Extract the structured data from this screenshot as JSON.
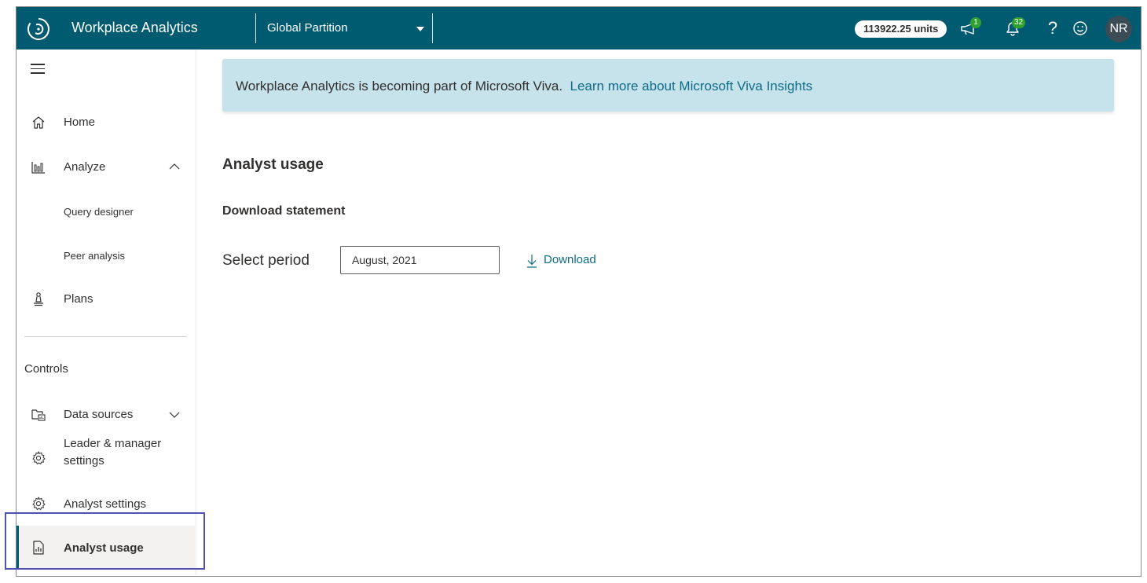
{
  "topbar": {
    "app_title": "Workplace Analytics",
    "partition": "Global Partition",
    "units": "113922.25 units",
    "announcements_badge": "1",
    "notifications_badge": "32",
    "help_glyph": "?",
    "avatar_initials": "NR",
    "colors": {
      "bar": "#005a70",
      "badge": "#2fa12f"
    },
    "icons": [
      "logo-icon",
      "announcement-icon",
      "bell-icon",
      "help-icon",
      "smiley-icon"
    ]
  },
  "sidebar": {
    "nav": {
      "home": "Home",
      "analyze": "Analyze",
      "query_designer": "Query designer",
      "peer_analysis": "Peer analysis",
      "plans": "Plans"
    },
    "controls_heading": "Controls",
    "controls": {
      "data_sources": "Data sources",
      "leader_manager_line1": "Leader & manager",
      "leader_manager_line2": "settings",
      "analyst_settings": "Analyst settings",
      "analyst_usage": "Analyst usage"
    },
    "active_item": "Analyst usage",
    "icons": [
      "hamburger-icon",
      "home-icon",
      "analyze-chart-icon",
      "chevron-up-icon",
      "plans-icon",
      "data-sources-icon",
      "chevron-down-icon",
      "gear-icon",
      "report-icon"
    ]
  },
  "main": {
    "banner": {
      "text": "Workplace Analytics is becoming part of Microsoft Viva.",
      "link": "Learn more about Microsoft Viva Insights"
    },
    "page_title": "Analyst usage",
    "section_title": "Download statement",
    "period_label": "Select period",
    "period_value": "August, 2021",
    "download_label": "Download",
    "colors": {
      "banner": "#c6e2ea",
      "link": "#0f6c88",
      "highlight_box": "#4f52b2"
    }
  }
}
